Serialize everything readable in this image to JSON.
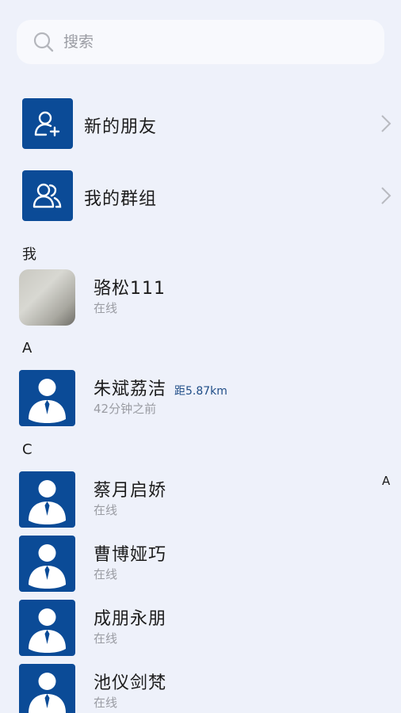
{
  "search": {
    "placeholder": "搜索",
    "icon": "search-icon"
  },
  "entries": [
    {
      "label": "新的朋友",
      "icon": "add-user-icon"
    },
    {
      "label": "我的群组",
      "icon": "group-icon"
    }
  ],
  "sections": {
    "me": "我",
    "a": "A",
    "c": "C"
  },
  "contacts": [
    {
      "name": "骆松111",
      "status": "在线"
    },
    {
      "name": "朱斌荔洁",
      "status": "42分钟之前",
      "distance": "距5.87km"
    },
    {
      "name": "蔡月启娇",
      "status": "在线"
    },
    {
      "name": "曹博娅巧",
      "status": "在线"
    },
    {
      "name": "成朋永朋",
      "status": "在线"
    },
    {
      "name": "池仪剑梵",
      "status": "在线"
    }
  ],
  "index_bar": {
    "letter": "A"
  },
  "colors": {
    "tile_blue": "#0b4b97",
    "background": "#eef1fa",
    "distance_text": "#1f4d87"
  }
}
